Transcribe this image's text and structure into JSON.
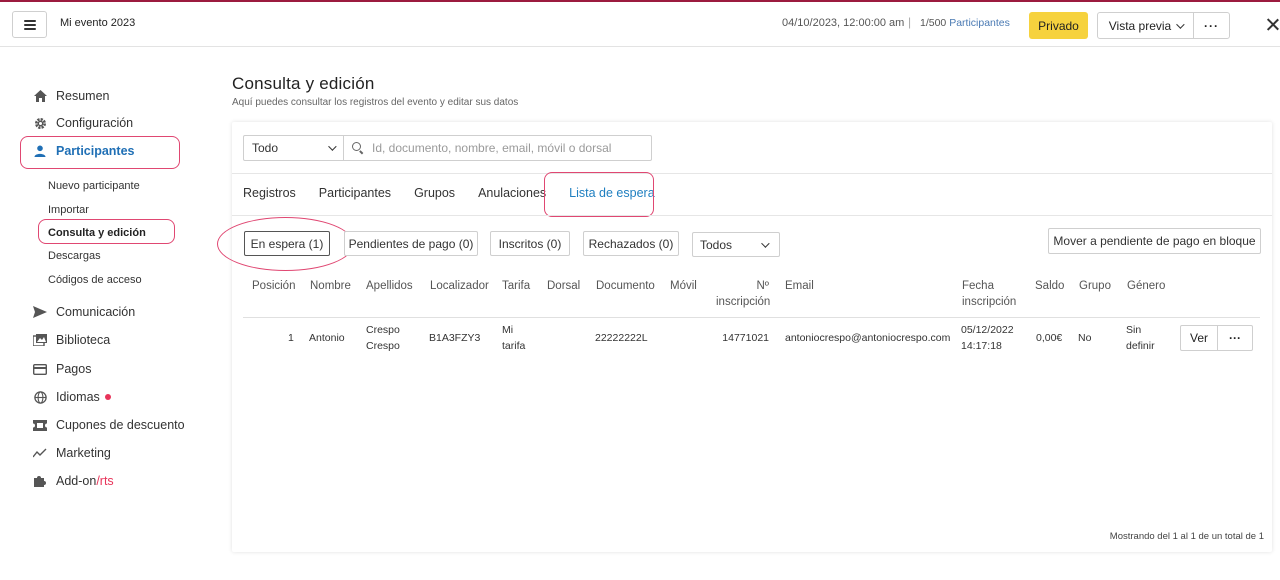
{
  "topbar": {
    "event_title": "Mi evento 2023",
    "date": "04/10/2023, 12:00:00 am",
    "separator": "|",
    "count": "1/500",
    "count_link": "Participantes",
    "private_label": "Privado",
    "preview_label": "Vista previa",
    "more_label": "···"
  },
  "sidebar": {
    "items": [
      {
        "label": "Resumen",
        "icon": "home-icon"
      },
      {
        "label": "Configuración",
        "icon": "gear-icon"
      },
      {
        "label": "Participantes",
        "icon": "user-icon"
      },
      {
        "label": "Comunicación",
        "icon": "send-icon"
      },
      {
        "label": "Biblioteca",
        "icon": "images-icon"
      },
      {
        "label": "Pagos",
        "icon": "card-icon"
      },
      {
        "label": "Idiomas",
        "icon": "globe-icon"
      },
      {
        "label": "Cupones de descuento",
        "icon": "ticket-icon"
      },
      {
        "label": "Marketing",
        "icon": "chart-line-icon"
      },
      {
        "label": "Add-on",
        "suffix": "/rts",
        "icon": "puzzle-icon"
      }
    ],
    "sub_items": [
      "Nuevo participante",
      "Importar",
      "Consulta y edición",
      "Descargas",
      "Códigos de acceso"
    ]
  },
  "page": {
    "title": "Consulta y edición",
    "subtitle": "Aquí puedes consultar los registros del evento y editar sus datos"
  },
  "filters": {
    "scope_value": "Todo",
    "search_placeholder": "Id, documento, nombre, email, móvil o dorsal"
  },
  "tabs": [
    "Registros",
    "Participantes",
    "Grupos",
    "Anulaciones",
    "Lista de espera"
  ],
  "status_pills": [
    "En espera (1)",
    "Pendientes de pago (0)",
    "Inscritos (0)",
    "Rechazados (0)"
  ],
  "status_select": "Todos",
  "bulk_button": "Mover a pendiente de pago en bloque",
  "table": {
    "headers": {
      "posicion": "Posición",
      "nombre": "Nombre",
      "apellidos": "Apellidos",
      "localizador": "Localizador",
      "tarifa": "Tarifa",
      "dorsal": "Dorsal",
      "documento": "Documento",
      "movil": "Móvil",
      "n_inscripcion_1": "Nº",
      "n_inscripcion_2": "inscripción",
      "email": "Email",
      "fecha_1": "Fecha",
      "fecha_2": "inscripción",
      "saldo": "Saldo",
      "grupo": "Grupo",
      "genero": "Género"
    },
    "rows": [
      {
        "posicion": "1",
        "nombre": "Antonio",
        "apellidos_1": "Crespo",
        "apellidos_2": "Crespo",
        "localizador": "B1A3FZY3",
        "tarifa_1": "Mi",
        "tarifa_2": "tarifa",
        "dorsal": "",
        "documento": "22222222L",
        "movil": "",
        "n_inscripcion": "14771021",
        "email": "antoniocrespo@antoniocrespo.com",
        "fecha_1": "05/12/2022",
        "fecha_2": "14:17:18",
        "saldo": "0,00€",
        "grupo": "No",
        "genero_1": "Sin",
        "genero_2": "definir",
        "view_label": "Ver",
        "more_label": "···"
      }
    ],
    "footer": "Mostrando del 1 al 1 de un total de 1"
  },
  "colors": {
    "accent_blue": "#1f6fb5",
    "highlight_pink": "#e04772",
    "private_yellow": "#f6d23e",
    "brand_top_border": "#9c1b3f"
  }
}
